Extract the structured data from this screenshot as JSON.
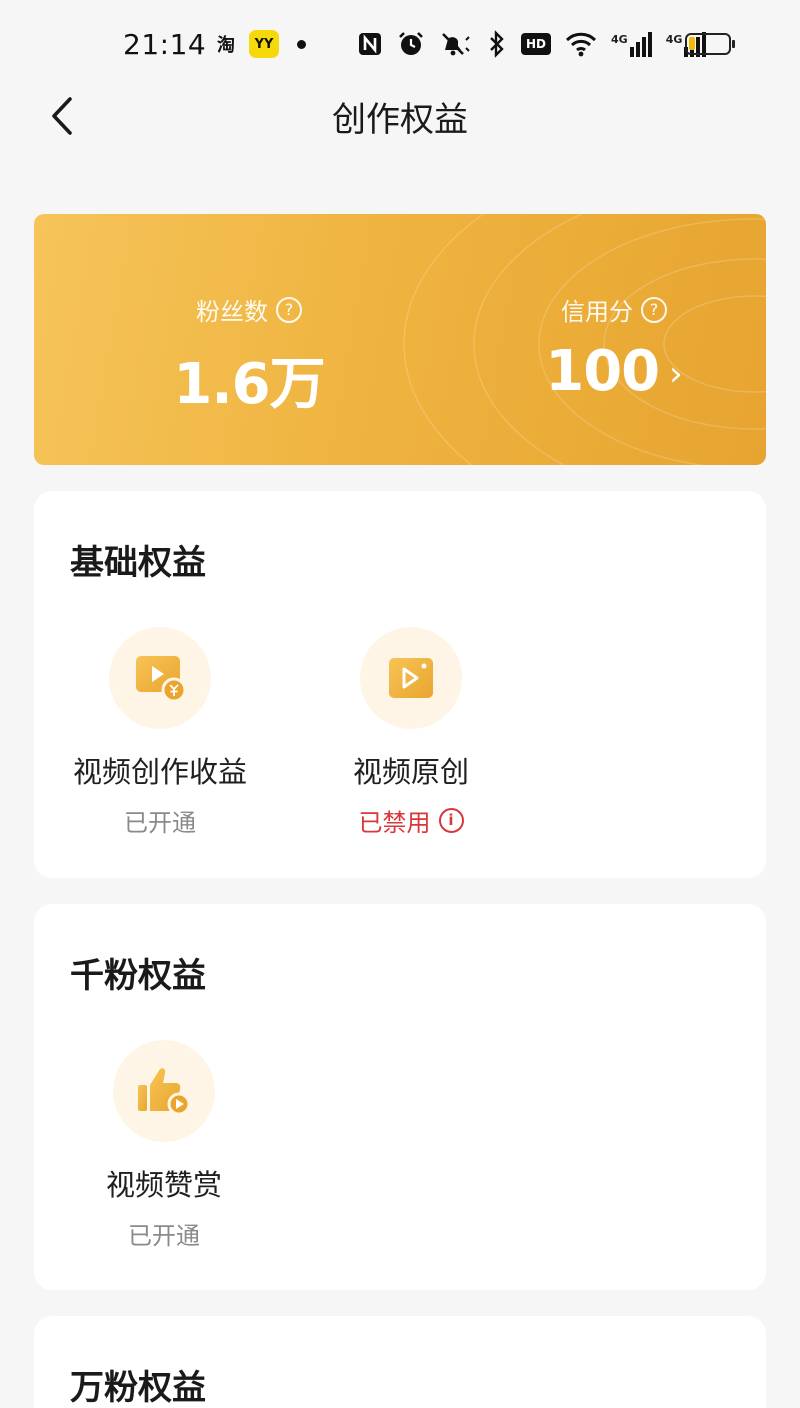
{
  "status_bar": {
    "time": "21:14",
    "taobao_label": "淘",
    "yy_label": "YY",
    "hd_label": "HD",
    "net_label_1": "4G",
    "net_label_2": "4G",
    "battery_level": 0.15
  },
  "header": {
    "title": "创作权益"
  },
  "stats": {
    "fans": {
      "label": "粉丝数",
      "value": "1.6万",
      "help": "?"
    },
    "credit": {
      "label": "信用分",
      "value": "100",
      "help": "?"
    }
  },
  "sections": {
    "basic": {
      "title": "基础权益",
      "items": [
        {
          "name": "视频创作收益",
          "status": "已开通"
        },
        {
          "name": "视频原创",
          "status": "已禁用",
          "info": "i"
        }
      ]
    },
    "thousand": {
      "title": "千粉权益",
      "items": [
        {
          "name": "视频赞赏",
          "status": "已开通"
        }
      ]
    },
    "tenk": {
      "title": "万粉权益"
    }
  },
  "colors": {
    "accent_start": "#f6c45a",
    "accent_end": "#e7a430",
    "disabled_red": "#d9383a",
    "icon_bg": "#fff5e6"
  }
}
